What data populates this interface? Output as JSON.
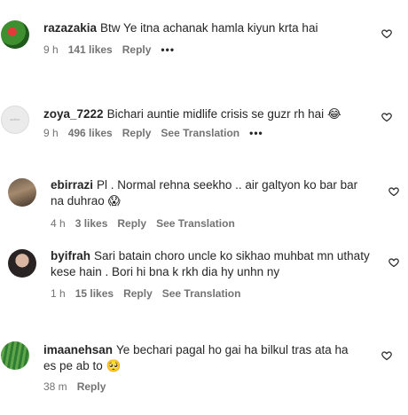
{
  "comments": [
    {
      "username": "razazakia",
      "text": "Btw Ye itna achanak hamla kiyun krta hai",
      "time": "9 h",
      "likes": "141 likes",
      "reply": "Reply",
      "see_translation": "",
      "more": "•••",
      "avatar": "green-red-flower-avatar"
    },
    {
      "username": "zoya_7222",
      "text": "Bichari auntie midlife crisis se guzr rh hai",
      "emoji": "😂",
      "time": "9 h",
      "likes": "496 likes",
      "reply": "Reply",
      "see_translation": "See Translation",
      "more": "•••",
      "avatar": "gray-placeholder-avatar"
    },
    {
      "username": "ebirrazi",
      "text": "Pl . Normal rehna seekho .. air galtyon ko bar bar na duhrao",
      "emoji": "😱",
      "time": "4 h",
      "likes": "3 likes",
      "reply": "Reply",
      "see_translation": "See Translation",
      "avatar": "photo-avatar"
    },
    {
      "username": "byifrah",
      "text": "Sari batain choro uncle ko sikhao muhbat mn uthaty kese hain . Bori hi bna k rkh dia hy unhn ny",
      "time": "1 h",
      "likes": "15 likes",
      "reply": "Reply",
      "see_translation": "See Translation",
      "avatar": "portrait-avatar"
    },
    {
      "username": "imaanehsan",
      "text": "Ye bechari pagal ho gai ha bilkul tras ata ha es pe ab to",
      "emoji": "🥺",
      "time": "38 m",
      "likes": "",
      "reply": "Reply",
      "see_translation": "",
      "avatar": "leaf-avatar"
    }
  ]
}
